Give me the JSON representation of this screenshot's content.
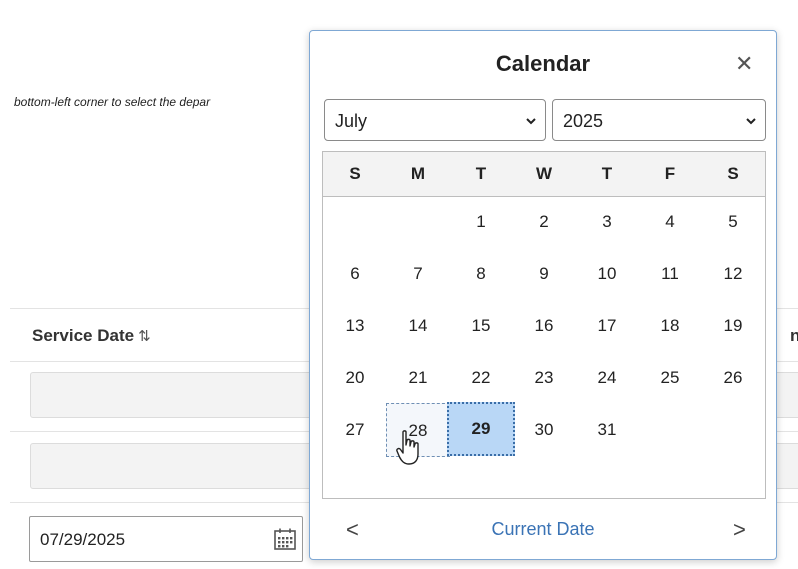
{
  "background_hint": "bottom-left corner to select the depar",
  "table": {
    "column_service_date": "Service Date",
    "sort_glyph": "⇅",
    "next_column_fragment": "ne"
  },
  "date_field": {
    "value": "07/29/2025"
  },
  "calendar": {
    "title": "Calendar",
    "close_glyph": "✕",
    "month": "July",
    "year": "2025",
    "weekdays": [
      "S",
      "M",
      "T",
      "W",
      "T",
      "F",
      "S"
    ],
    "weeks": [
      [
        "",
        "",
        "1",
        "2",
        "3",
        "4",
        "5"
      ],
      [
        "6",
        "7",
        "8",
        "9",
        "10",
        "11",
        "12"
      ],
      [
        "13",
        "14",
        "15",
        "16",
        "17",
        "18",
        "19"
      ],
      [
        "20",
        "21",
        "22",
        "23",
        "24",
        "25",
        "26"
      ],
      [
        "27",
        "28",
        "29",
        "30",
        "31",
        "",
        ""
      ]
    ],
    "selected_day": "29",
    "hovered_day": "28",
    "prev_glyph": "<",
    "next_glyph": ">",
    "current_date_label": "Current Date"
  },
  "colors": {
    "selected_bg": "#b9d7f6",
    "link": "#3a73b5",
    "popup_border": "#7fa8d4"
  }
}
